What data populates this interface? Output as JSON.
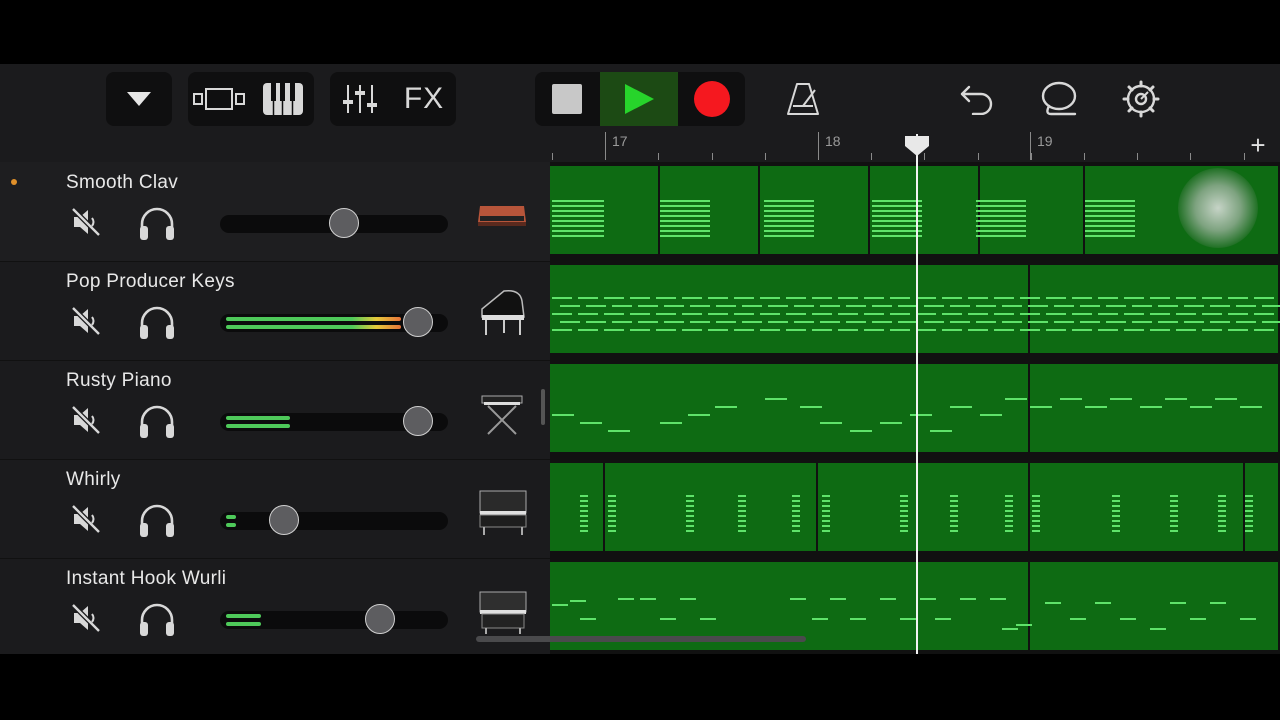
{
  "toolbar": {
    "tracks_menu_icon": "triangle-down-icon",
    "view_icon": "tracks-view-icon",
    "keys_icon": "keyboard-icon",
    "mixer_icon": "sliders-icon",
    "fx_label": "FX",
    "stop_icon": "stop-icon",
    "play_icon": "play-icon",
    "record_icon": "record-icon",
    "metronome_icon": "metronome-icon",
    "undo_icon": "undo-icon",
    "loops_icon": "lasso-icon",
    "settings_icon": "gear-icon",
    "colors": {
      "play_bg": "#1c4a14",
      "play": "#27d42b",
      "record": "#f5181f"
    }
  },
  "ruler": {
    "bars": [
      "17",
      "18",
      "19"
    ],
    "add_label": "+"
  },
  "tracks": [
    {
      "name": "Smooth Clav",
      "volume": 0.55,
      "meter": 0,
      "selected": true,
      "instrument": "clavinet-icon"
    },
    {
      "name": "Pop Producer Keys",
      "volume": 0.92,
      "meter": 0.9,
      "selected": false,
      "instrument": "grand-piano-icon"
    },
    {
      "name": "Rusty Piano",
      "volume": 0.92,
      "meter": 0.33,
      "selected": false,
      "instrument": "keyboard-stand-icon"
    },
    {
      "name": "Whirly",
      "volume": 0.25,
      "meter": 0.05,
      "selected": false,
      "instrument": "upright-electric-piano-icon"
    },
    {
      "name": "Instant Hook Wurli",
      "volume": 0.73,
      "meter": 0.18,
      "selected": false,
      "instrument": "wurlitzer-icon"
    }
  ],
  "colors": {
    "region": "#0e6b13",
    "note": "#5fe36a",
    "meter_green": "#4ec95a",
    "meter_hot": "#e8a63a"
  }
}
